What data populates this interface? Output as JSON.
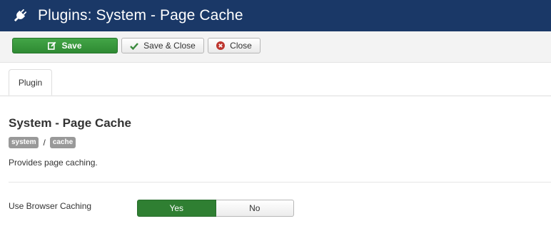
{
  "header": {
    "title": "Plugins: System - Page Cache",
    "icon": "plug-icon",
    "background": "#1a3867"
  },
  "toolbar": {
    "save_label": "Save",
    "save_close_label": "Save & Close",
    "close_label": "Close"
  },
  "tabs": [
    {
      "label": "Plugin",
      "active": true
    }
  ],
  "plugin": {
    "title": "System - Page Cache",
    "badges": [
      "system",
      "cache"
    ],
    "badge_separator": "/",
    "description": "Provides page caching."
  },
  "fields": {
    "browser_caching": {
      "label": "Use Browser Caching",
      "options": [
        "Yes",
        "No"
      ],
      "selected": "Yes"
    }
  },
  "colors": {
    "accent_green": "#2f7f32",
    "badge_gray": "#999999"
  }
}
